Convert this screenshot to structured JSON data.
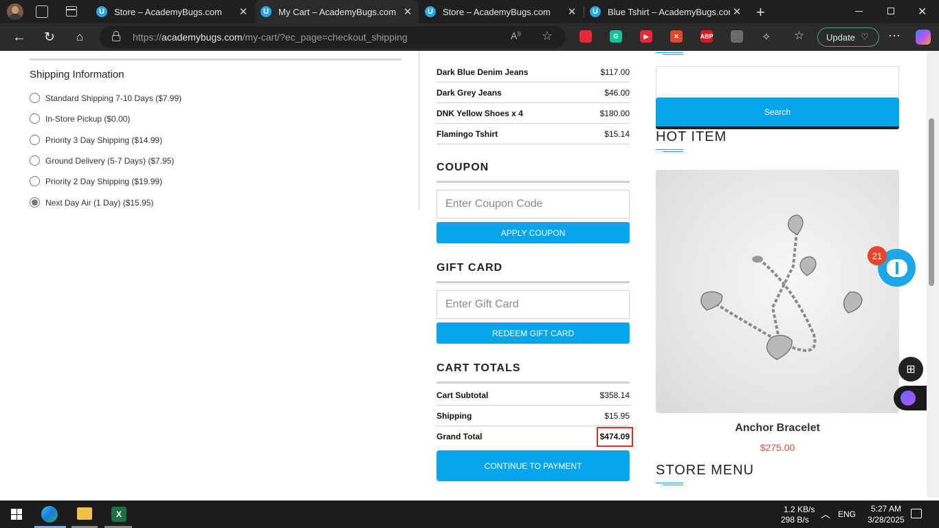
{
  "browser": {
    "tabs": [
      {
        "title": "Store – AcademyBugs.com",
        "active": false
      },
      {
        "title": "My Cart – AcademyBugs.com",
        "active": true
      },
      {
        "title": "Store – AcademyBugs.com",
        "active": false
      },
      {
        "title": "Blue Tshirt – AcademyBugs.com",
        "active": false
      }
    ],
    "favicon_letter": "U",
    "url_prefix": "https://",
    "url_domain": "academybugs.com",
    "url_path": "/my-cart/?ec_page=checkout_shipping",
    "update_label": "Update",
    "extensions": [
      {
        "name": "ext-red-icon",
        "text": "",
        "color": "#e6293a"
      },
      {
        "name": "grammarly-icon",
        "text": "G",
        "color": "#15c39a"
      },
      {
        "name": "video-icon",
        "text": "▶",
        "color": "#e6293a"
      },
      {
        "name": "tool-icon",
        "text": "✕",
        "color": "#e1482b"
      },
      {
        "name": "adblock-icon",
        "text": "ABP",
        "color": "#d71920"
      },
      {
        "name": "shield-ext-icon",
        "text": "",
        "color": "#6b6b6b"
      }
    ]
  },
  "shipping": {
    "title": "Shipping Information",
    "options": [
      {
        "label": "Standard Shipping 7-10 Days ($7.99)",
        "checked": false
      },
      {
        "label": "In-Store Pickup ($0.00)",
        "checked": false
      },
      {
        "label": "Priority 3 Day Shipping ($14.99)",
        "checked": false
      },
      {
        "label": "Ground Delivery (5-7 Days) ($7.95)",
        "checked": false
      },
      {
        "label": "Priority 2 Day Shipping ($19.99)",
        "checked": false
      },
      {
        "label": "Next Day Air (1 Day) ($15.95)",
        "checked": true
      }
    ]
  },
  "cart_items": [
    {
      "name": "Dark Blue Denim Jeans",
      "price": "$117.00"
    },
    {
      "name": "Dark Grey Jeans",
      "price": "$46.00"
    },
    {
      "name": "DNK Yellow Shoes x 4",
      "price": "$180.00"
    },
    {
      "name": "Flamingo Tshirt",
      "price": "$15.14"
    }
  ],
  "coupon": {
    "heading": "COUPON",
    "placeholder": "Enter Coupon Code",
    "button": "APPLY COUPON"
  },
  "gift_card": {
    "heading": "GIFT CARD",
    "placeholder": "Enter Gift Card",
    "button": "REDEEM GIFT CARD"
  },
  "totals": {
    "heading": "CART TOTALS",
    "subtotal_label": "Cart Subtotal",
    "subtotal": "$358.14",
    "shipping_label": "Shipping",
    "shipping": "$15.95",
    "grand_label": "Grand Total",
    "grand": "$474.09",
    "continue_button": "CONTINUE TO PAYMENT"
  },
  "sidebar": {
    "search_button": "Search",
    "hot_item_heading": "HOT ITEM",
    "product_name": "Anchor Bracelet",
    "product_price": "$275.00",
    "store_menu_heading": "STORE MENU",
    "bug_badge_count": "21"
  },
  "taskbar": {
    "net_up": "1.2 KB/s",
    "net_down": "298 B/s",
    "lang": "ENG",
    "time": "5:27 AM",
    "date": "3/28/2025"
  },
  "colors": {
    "accent": "#04a6e9",
    "price_red": "#e74c3c",
    "highlight_box": "#d93025"
  }
}
